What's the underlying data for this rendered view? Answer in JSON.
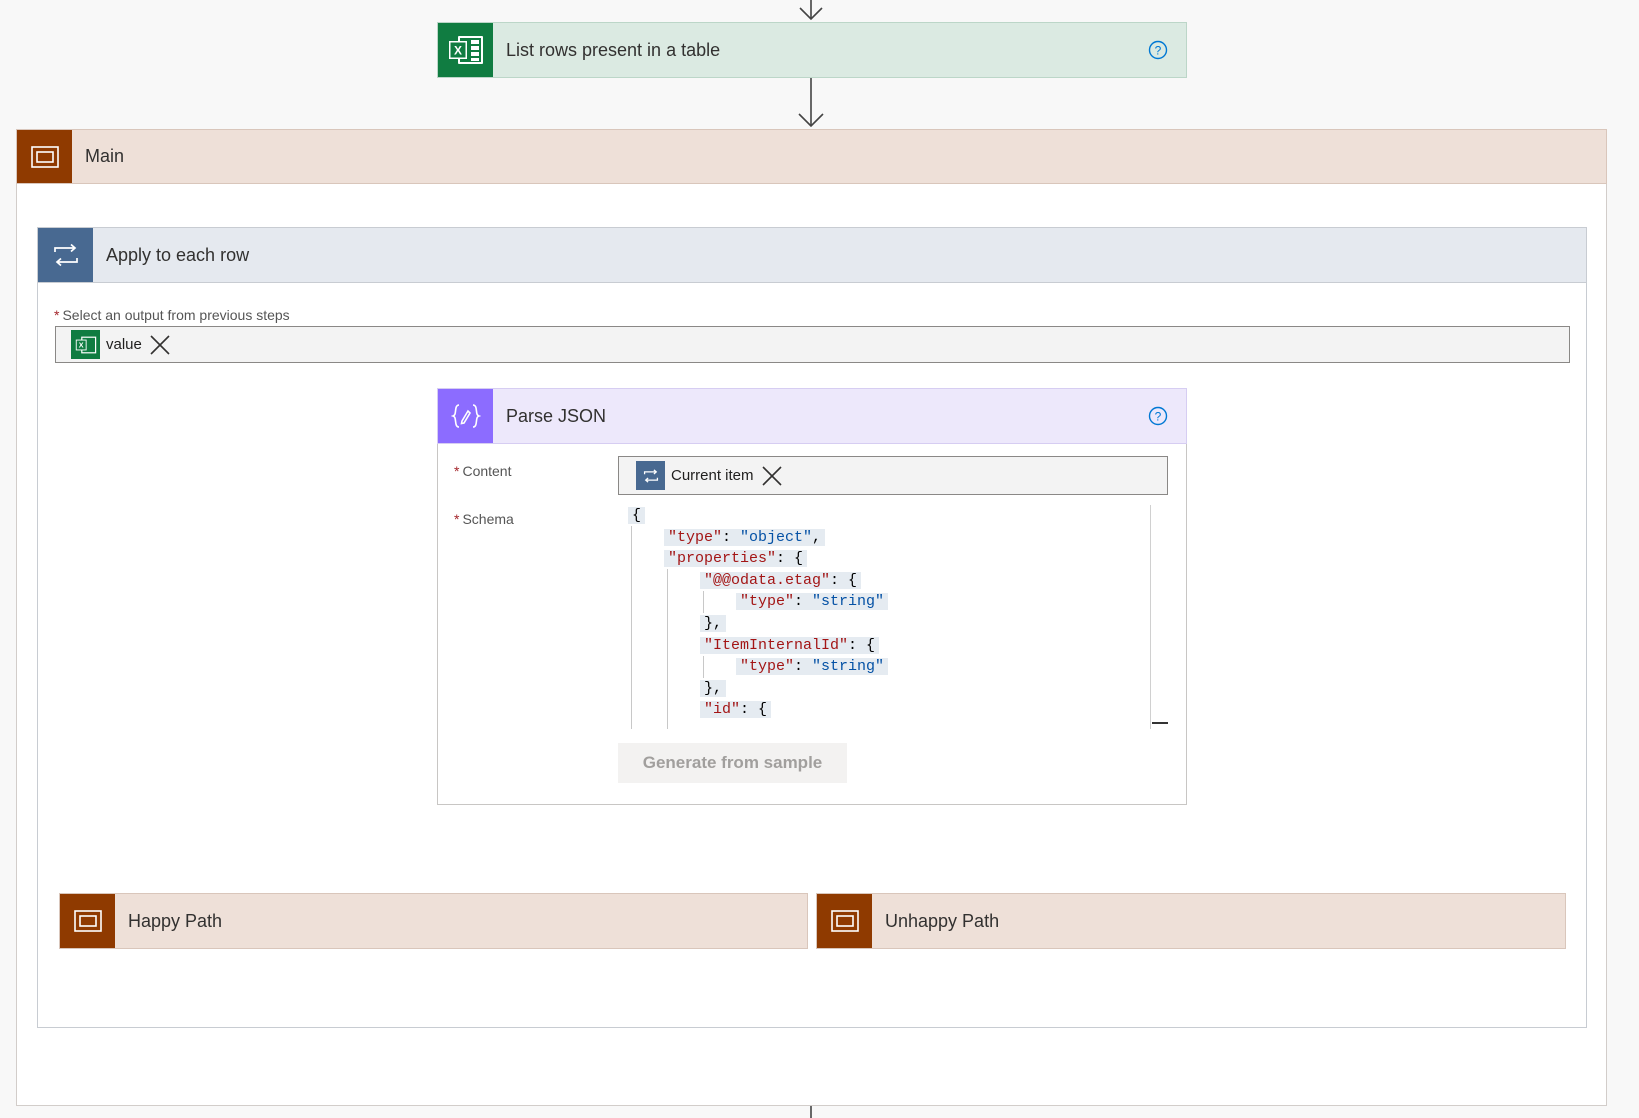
{
  "steps": {
    "list_rows": {
      "title": "List rows present in a table",
      "icon": "excel-icon",
      "header_color": "#dbeae2",
      "icon_color": "#107c41"
    },
    "main_scope": {
      "title": "Main",
      "icon": "scope-icon",
      "header_color": "#eee0d8",
      "icon_color": "#8f3a00"
    },
    "apply_each": {
      "title": "Apply to each row",
      "icon": "loop-icon",
      "header_color": "#e5e9ef",
      "icon_color": "#486991",
      "select_label": "Select an output from previous steps",
      "token_label": "value"
    },
    "parse_json": {
      "title": "Parse JSON",
      "icon": "parse-json-icon",
      "header_color": "#ede8fb",
      "icon_color": "#8c6cff",
      "content_label": "Content",
      "content_token": "Current item",
      "schema_label": "Schema",
      "schema_lines": [
        "{",
        "\"type\": \"object\",",
        "\"properties\": {",
        "\"@@odata.etag\": {",
        "\"type\": \"string\"",
        "},",
        "\"ItemInternalId\": {",
        "\"type\": \"string\"",
        "},",
        "\"id\": {"
      ],
      "generate_button": "Generate from sample"
    },
    "happy_path": {
      "title": "Happy Path",
      "icon": "scope-icon"
    },
    "unhappy_path": {
      "title": "Unhappy Path",
      "icon": "scope-icon"
    }
  },
  "required_marker": "*"
}
